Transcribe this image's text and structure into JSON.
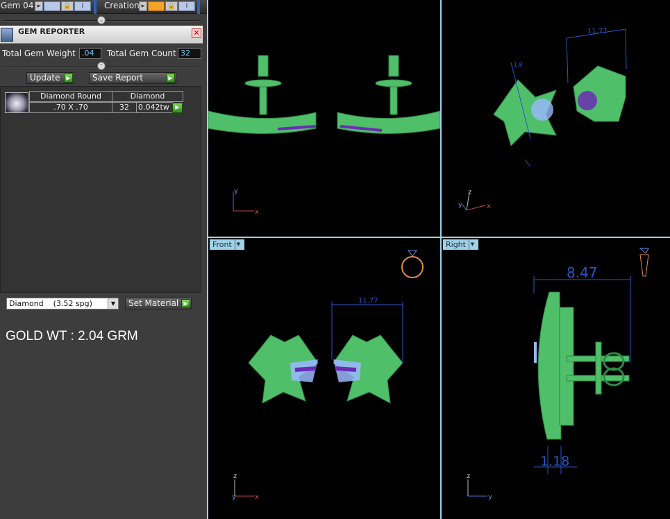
{
  "toolbar": {
    "gem_label": "Gem 04",
    "creation_label": "Creation",
    "gem_color": "#b9c8e6",
    "creation_color": "#f0a428"
  },
  "gem_reporter": {
    "title": "GEM REPORTER",
    "total_weight_label": "Total Gem Weight",
    "total_weight_value": ".04",
    "total_count_label": "Total Gem Count",
    "total_count_value": "32",
    "update_label": "Update",
    "save_report_label": "Save Report",
    "table": {
      "headers": [
        "Diamond Round",
        "Diamond"
      ],
      "rows": [
        {
          "size": ".70 X .70",
          "count": "32",
          "weight": "0.042tw"
        }
      ]
    }
  },
  "material": {
    "selected": "Diamond    (3.52 spg)",
    "set_material_label": "Set Material"
  },
  "gold_weight": "GOLD WT : 2.04 GRM",
  "viewports": {
    "front_label": "Front",
    "right_label": "Right",
    "top_right_dimension": "11.77",
    "top_right_small_dimension": "1.8",
    "front_dimension": "11.77",
    "right_dimension_width": "8.47",
    "right_dimension_base": "1.18",
    "axis_x": "x",
    "axis_y": "y",
    "axis_z": "z"
  },
  "colors": {
    "metal": "#5fd07a",
    "gem_blue": "#9ab8ff",
    "gem_purple": "#6b2bb3",
    "dimension": "#2a56c6"
  }
}
